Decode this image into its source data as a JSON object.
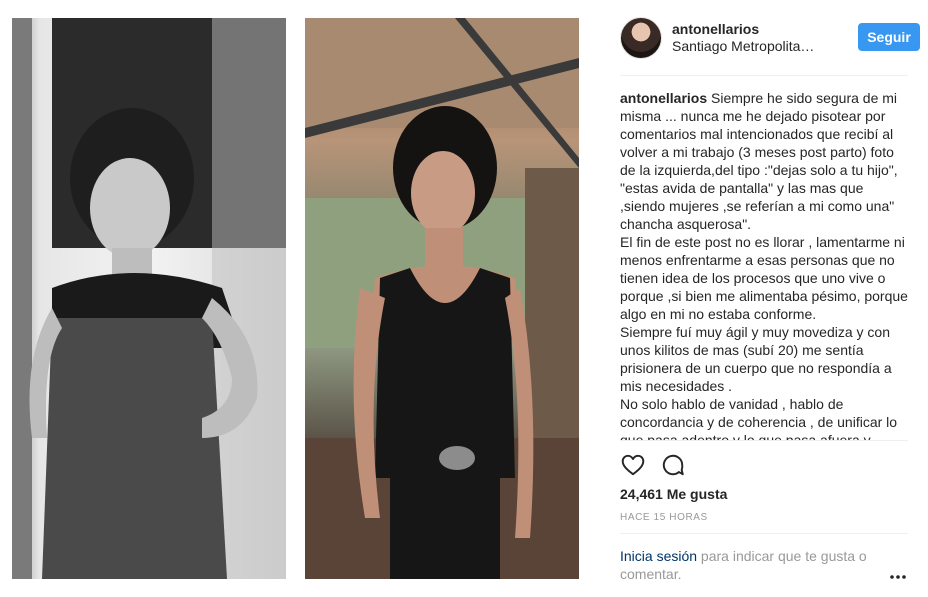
{
  "post": {
    "username": "antonellarios",
    "location": "Santiago Metropolitan Region",
    "follow_label": "Seguir",
    "caption_user": "antonellarios",
    "caption_text": "Siempre he sido segura de mi misma ... nunca me he dejado pisotear por comentarios mal intencionados que recibí al volver a mi trabajo (3 meses post parto) foto de la izquierda,del tipo :\"dejas solo a tu hijo\", \"estas avida de pantalla\" y las mas que ,siendo mujeres ,se referían a mi como una\" chancha asquerosa\".\nEl fin de este post no es llorar , lamentarme ni menos enfrentarme a esas personas que no tienen idea de los procesos que uno vive o porque ,si bien me alimentaba pésimo, porque algo en mi no estaba conforme.\nSiempre fuí muy ágil y muy movediza y con unos kilitos de mas (subí 20) me sentía prisionera de un cuerpo que no respondía a mis necesidades .\nNo solo hablo de vanidad , hablo de concordancia y de coherencia , de unificar lo que pasa adentro y lo que pasa afuera y",
    "likes": "24,461 Me gusta",
    "time_ago": "HACE 15 HORAS",
    "login_link": "Inicia sesión",
    "login_rest": " para indicar que te gusta o comentar."
  },
  "icons": {
    "like": "heart-icon",
    "comment": "comment-icon",
    "more": "more-options-icon"
  },
  "colors": {
    "accent": "#3897f0",
    "link": "#003569",
    "muted": "#999999",
    "divider": "#efefef"
  }
}
